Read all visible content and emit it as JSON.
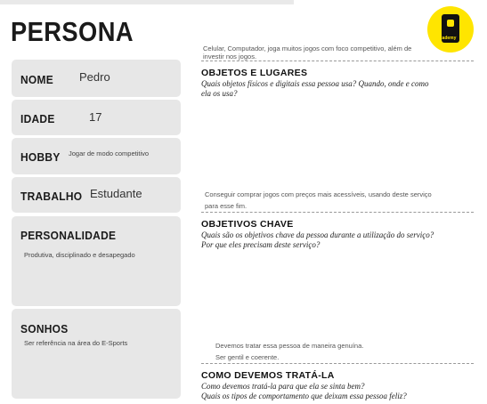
{
  "page_title": "PERSONA",
  "logo": {
    "icon": "academy-logo-icon",
    "text": "academy",
    "color": "#ffe500"
  },
  "cards": {
    "nome": {
      "label": "NOME",
      "value": "Pedro"
    },
    "idade": {
      "label": "IDADE",
      "value": "17"
    },
    "hobby": {
      "label": "HOBBY",
      "value": "Jogar de modo competitivo"
    },
    "trabalho": {
      "label": "TRABALHO",
      "value": "Estudante"
    },
    "personalidade": {
      "label": "PERSONALIDADE",
      "value": "Produtiva, disciplinado e desapegado"
    },
    "sonhos": {
      "label": "SONHOS",
      "value": "Ser referência na área do E-Sports"
    }
  },
  "sections": {
    "objetos": {
      "note_line1": "Celular, Computador, joga muitos jogos com foco competitivo, além de",
      "note_line2": "investir nos jogos.",
      "title": "OBJETOS E LUGARES",
      "q_line1": "Quais objetos físicos e digitais essa pessoa usa? Quando, onde e como",
      "q_line2": "ela os usa?"
    },
    "objetivos": {
      "note_line1": "Conseguir comprar jogos com preços mais acessíveis, usando deste serviço",
      "note_line2": "para esse fim.",
      "title": "OBJETIVOS CHAVE",
      "q_line1": "Quais são os objetivos chave da pessoa durante a utilização do serviço?",
      "q_line2": "Por que eles precisam deste serviço?"
    },
    "tratar": {
      "note_line1": "Devemos tratar essa pessoa de maneira genuína.",
      "note_line2": "Ser gentil e coerente.",
      "title": "COMO DEVEMOS TRATÁ-LA",
      "q_line1": "Como devemos tratá-la para que ela se sinta bem?",
      "q_line2": "Quais os tipos de comportamento que deixam essa pessoa feliz?"
    }
  }
}
